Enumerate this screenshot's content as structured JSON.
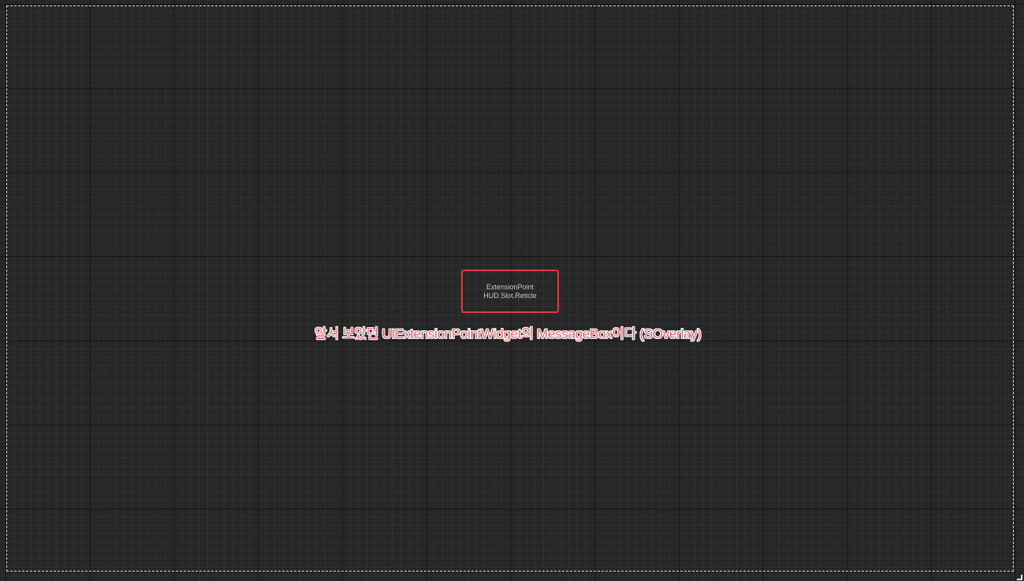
{
  "viewport": {
    "message_box": {
      "line1": "ExtensionPoint",
      "line2": "HUD.Slot.Reticle"
    },
    "annotation": "앞서 보았던 UIExtensionPointWidget의 MessageBox이다 (SOverlay)"
  },
  "colors": {
    "background": "#272727",
    "highlight": "#e23a3e",
    "annotation_text": "#ff3b4a",
    "safe_zone_border": "#d8d8d8"
  }
}
